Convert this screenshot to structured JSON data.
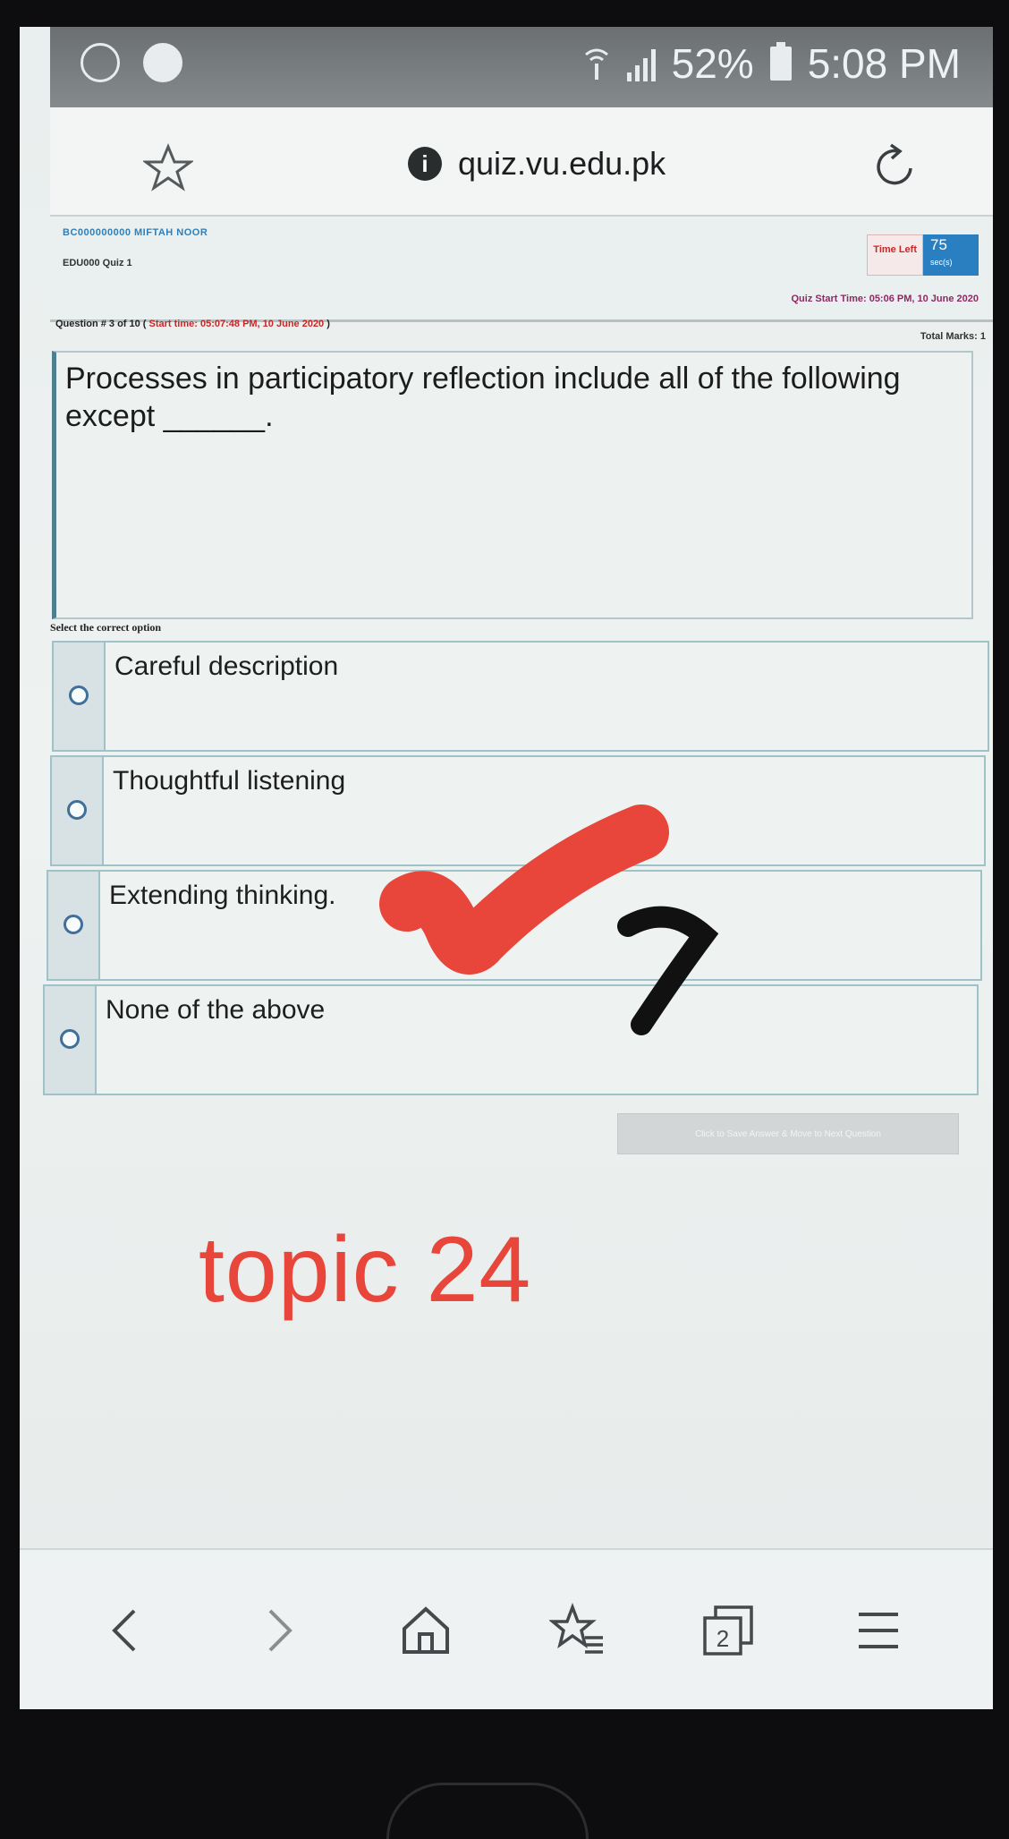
{
  "status_bar": {
    "battery_percent": "52%",
    "time": "5:08 PM",
    "icons": [
      "messenger-icon",
      "notification-icon",
      "wifi-icon",
      "signal-icon",
      "battery-icon"
    ]
  },
  "browser": {
    "url": "quiz.vu.edu.pk",
    "icons": [
      "star-icon",
      "info-icon",
      "reload-icon"
    ]
  },
  "quiz_header": {
    "student": "BC000000000 MIFTAH NOOR",
    "quiz_title": "EDU000 Quiz 1",
    "time_left_label": "Time Left",
    "time_left_value": "75",
    "time_left_unit": "sec(s)",
    "quiz_start_time": "Quiz Start Time: 05:06 PM, 10 June 2020"
  },
  "question": {
    "number_label": "Question # 3 of 10 (",
    "start_time": "Start time: 05:07:48 PM, 10 June 2020",
    "number_label_end": ")",
    "total_marks": "Total Marks: 1",
    "text": "Processes in participatory reflection include all of the following except ______.",
    "select_label": "Select the correct option",
    "options": [
      "Careful description",
      "Thoughtful listening",
      "Extending thinking.",
      "None of the above"
    ]
  },
  "actions": {
    "next_button": "Click to Save Answer & Move to Next Question"
  },
  "annotation": {
    "text": "topic 24",
    "color": "#e8463a"
  },
  "bottom_nav": {
    "tabs_count": "2",
    "icons": [
      "back-icon",
      "forward-icon",
      "home-icon",
      "bookmarks-icon",
      "tabs-icon",
      "menu-icon"
    ]
  }
}
